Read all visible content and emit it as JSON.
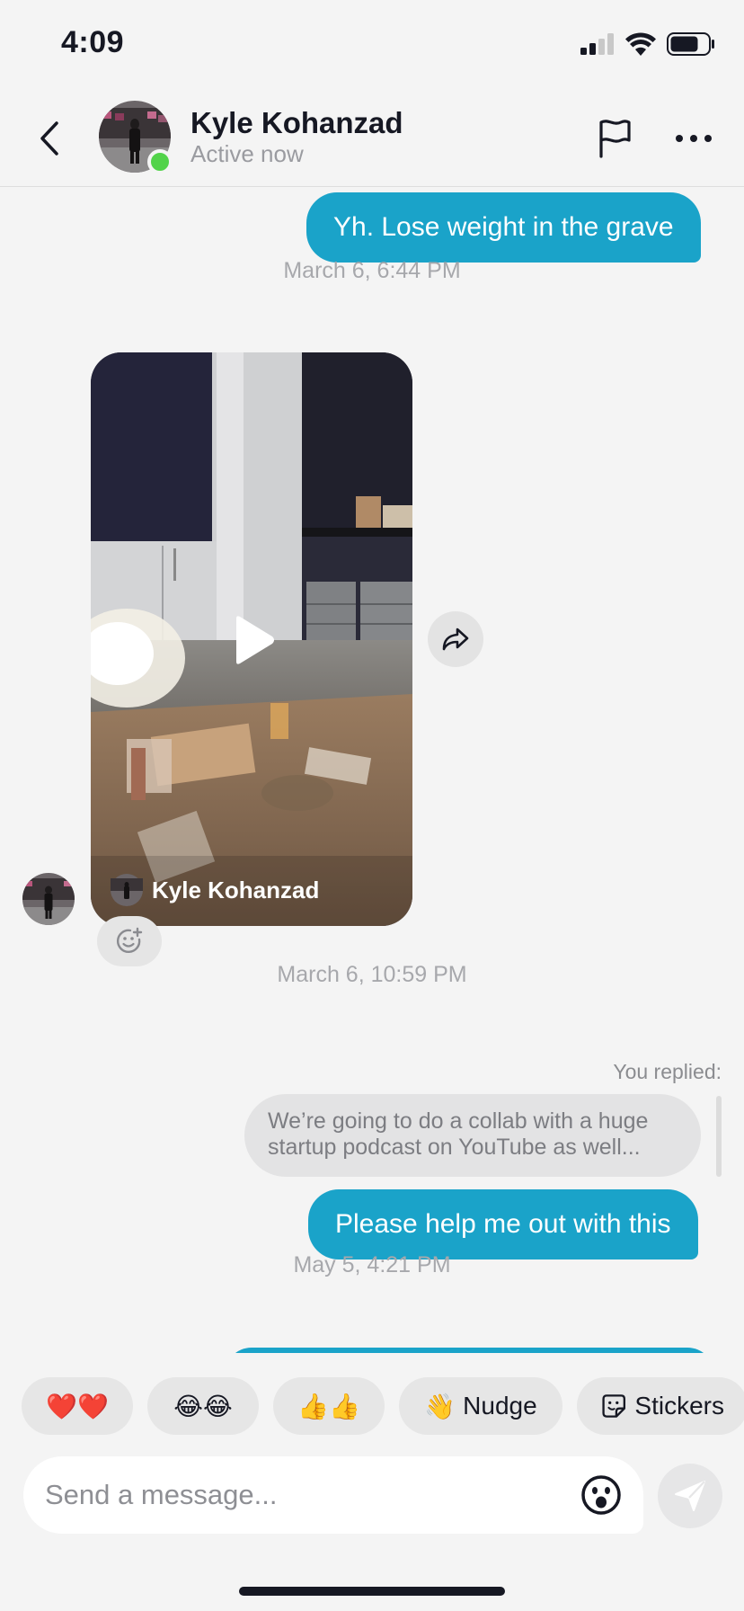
{
  "status_bar": {
    "time": "4:09"
  },
  "header": {
    "name": "Kyle Kohanzad",
    "status": "Active now"
  },
  "messages": {
    "msg1": "Yh. Lose weight in the grave",
    "ts1": "March 6, 6:44 PM",
    "video_owner": "Kyle Kohanzad",
    "ts2": "March 6, 10:59 PM",
    "replied_label": "You replied:",
    "quote": "We’re going to do a collab with a huge startup podcast on YouTube as well...",
    "msg2": "Please help me out with this",
    "ts3": "May 5, 4:21 PM"
  },
  "chips": [
    {
      "emoji": "❤️❤️",
      "label": ""
    },
    {
      "emoji": "😂😂",
      "label": ""
    },
    {
      "emoji": "👍👍",
      "label": ""
    },
    {
      "emoji": "👋",
      "label": "Nudge"
    },
    {
      "emoji": "",
      "label": "Stickers"
    }
  ],
  "composer": {
    "placeholder": "Send a message..."
  },
  "icons": {
    "back": "chevron-left-icon",
    "flag": "flag-icon",
    "more": "more-horizontal-icon",
    "share": "share-arrow-icon",
    "react": "add-reaction-icon",
    "emoji": "emoji-face-icon",
    "send": "send-icon",
    "play": "play-icon",
    "sticker": "sticker-icon"
  },
  "colors": {
    "accent": "#1aa3c9",
    "online": "#52d34a",
    "background": "#f4f4f4"
  }
}
